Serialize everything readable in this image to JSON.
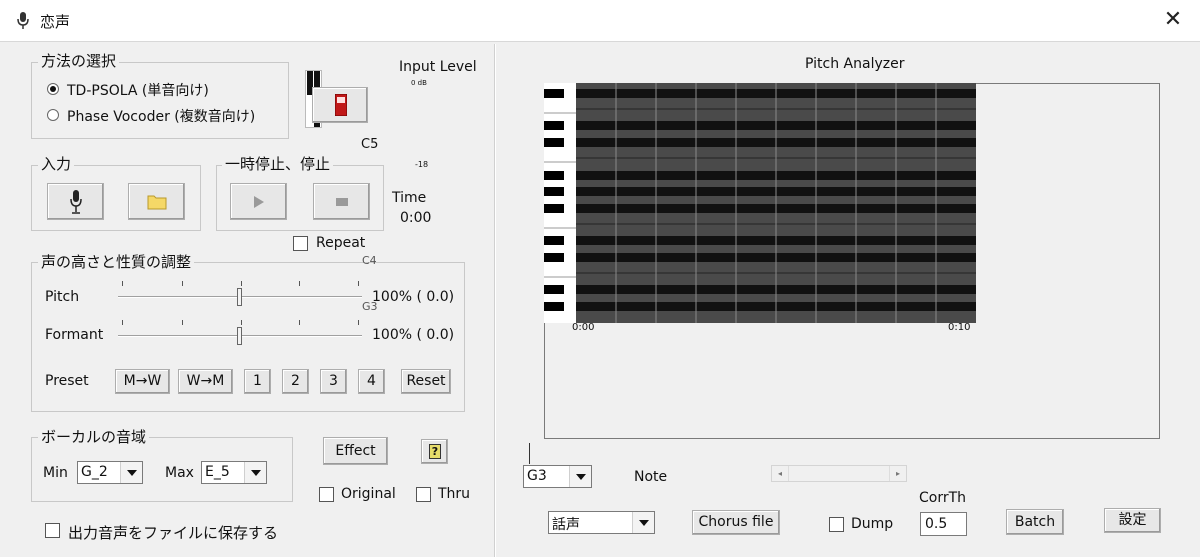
{
  "window": {
    "title": "恋声",
    "close": "✕"
  },
  "method": {
    "title": "方法の選択",
    "options": [
      {
        "label": "TD-PSOLA (単音向け)",
        "selected": true
      },
      {
        "label": "Phase Vocoder (複数音向け)",
        "selected": false
      }
    ]
  },
  "meter": {
    "input_level": "Input Level",
    "db0": "0 dB",
    "db18": "-18",
    "c5": "C5",
    "c4": "C4",
    "g3": "G3"
  },
  "input": {
    "title": "入力"
  },
  "pause": {
    "title": "一時停止、停止"
  },
  "time": {
    "label": "Time",
    "value": "0:00"
  },
  "repeat": {
    "label": "Repeat"
  },
  "adjust": {
    "title": "声の高さと性質の調整",
    "pitch_label": "Pitch",
    "pitch_value": "100% ( 0.0)",
    "pitch_level": 0.5,
    "formant_label": "Formant",
    "formant_value": "100% ( 0.0)",
    "formant_level": 0.5,
    "preset_label": "Preset",
    "presets": [
      "M→W",
      "W→M",
      "1",
      "2",
      "3",
      "4",
      "Reset"
    ]
  },
  "range": {
    "title": "ボーカルの音域",
    "min_label": "Min",
    "min_value": "G_2",
    "max_label": "Max",
    "max_value": "E_5"
  },
  "effect": {
    "label": "Effect",
    "help": "?"
  },
  "original": {
    "label": "Original"
  },
  "thru": {
    "label": "Thru"
  },
  "save": {
    "label": "出力音声をファイルに保存する"
  },
  "analyzer": {
    "title": "Pitch Analyzer",
    "t_start": "0:00",
    "t_end": "0:10"
  },
  "note": {
    "combo_value": "G3",
    "label": "Note"
  },
  "bottom": {
    "mode_value": "話声",
    "chorus_label": "Chorus file",
    "dump_label": "Dump",
    "corr_label": "CorrTh",
    "corr_value": "0.5",
    "batch_label": "Batch",
    "settings_label": "設定"
  }
}
